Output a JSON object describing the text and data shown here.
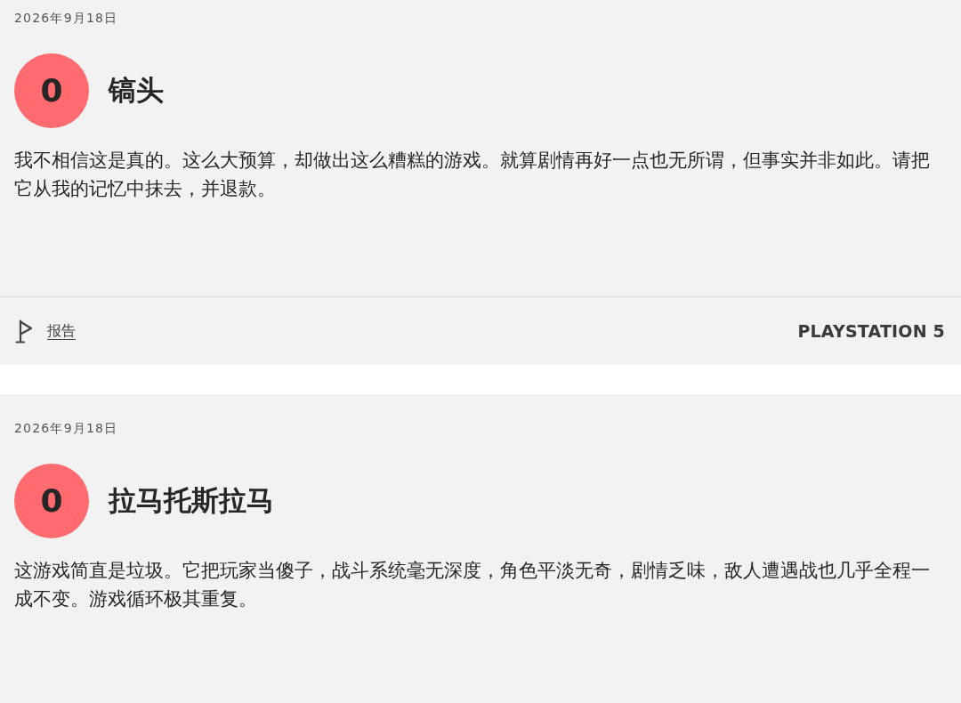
{
  "reviews": [
    {
      "date": "2026年9月18日",
      "score": "0",
      "title": "镐头",
      "body": "我不相信这是真的。这么大预算，却做出这么糟糕的游戏。就算剧情再好一点也无所谓，但事实并非如此。请把它从我的记忆中抹去，并退款。",
      "report_label": "报告",
      "platform": "PLAYSTATION 5"
    },
    {
      "date": "2026年9月18日",
      "score": "0",
      "title": "拉马托斯拉马",
      "body": "这游戏简直是垃圾。它把玩家当傻子，战斗系统毫无深度，角色平淡无奇，剧情乏味，敌人遭遇战也几乎全程一成不变。游戏循环极其重复。"
    }
  ]
}
